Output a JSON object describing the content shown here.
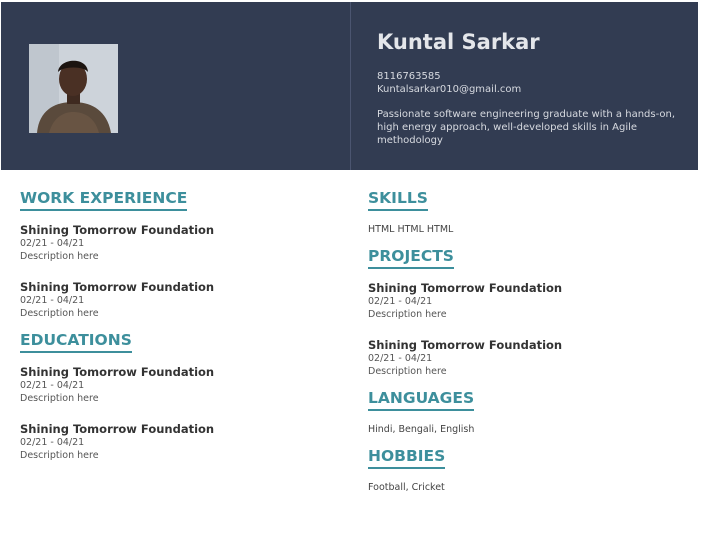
{
  "header": {
    "name": "Kuntal Sarkar",
    "phone": "8116763585",
    "email": "Kuntalsarkar010@gmail.com",
    "summary": "Passionate software engineering graduate with a hands-on, high energy approach, well-developed skills in Agile methodology",
    "colors": {
      "background": "#323c52",
      "text": "#e4e6ea"
    }
  },
  "accent_color": "#3d8f9c",
  "work_experience": {
    "title": "WORK EXPERIENCE",
    "entries": [
      {
        "org": "Shining Tomorrow Foundation",
        "dates": "02/21 - 04/21",
        "desc": "Description here"
      },
      {
        "org": "Shining Tomorrow Foundation",
        "dates": "02/21 - 04/21",
        "desc": "Description here"
      }
    ]
  },
  "education": {
    "title": "EDUCATIONS",
    "entries": [
      {
        "org": "Shining Tomorrow Foundation",
        "dates": "02/21 - 04/21",
        "desc": "Description here"
      },
      {
        "org": "Shining Tomorrow Foundation",
        "dates": "02/21 - 04/21",
        "desc": "Description here"
      }
    ]
  },
  "skills": {
    "title": "SKILLS",
    "text": "HTML HTML HTML"
  },
  "projects": {
    "title": "PROJECTS",
    "entries": [
      {
        "org": "Shining Tomorrow Foundation",
        "dates": "02/21 - 04/21",
        "desc": "Description here"
      },
      {
        "org": "Shining Tomorrow Foundation",
        "dates": "02/21 - 04/21",
        "desc": "Description here"
      }
    ]
  },
  "languages": {
    "title": "LANGUAGES",
    "text": "Hindi, Bengali, English"
  },
  "hobbies": {
    "title": "HOBBIES",
    "text": "Football, Cricket"
  }
}
